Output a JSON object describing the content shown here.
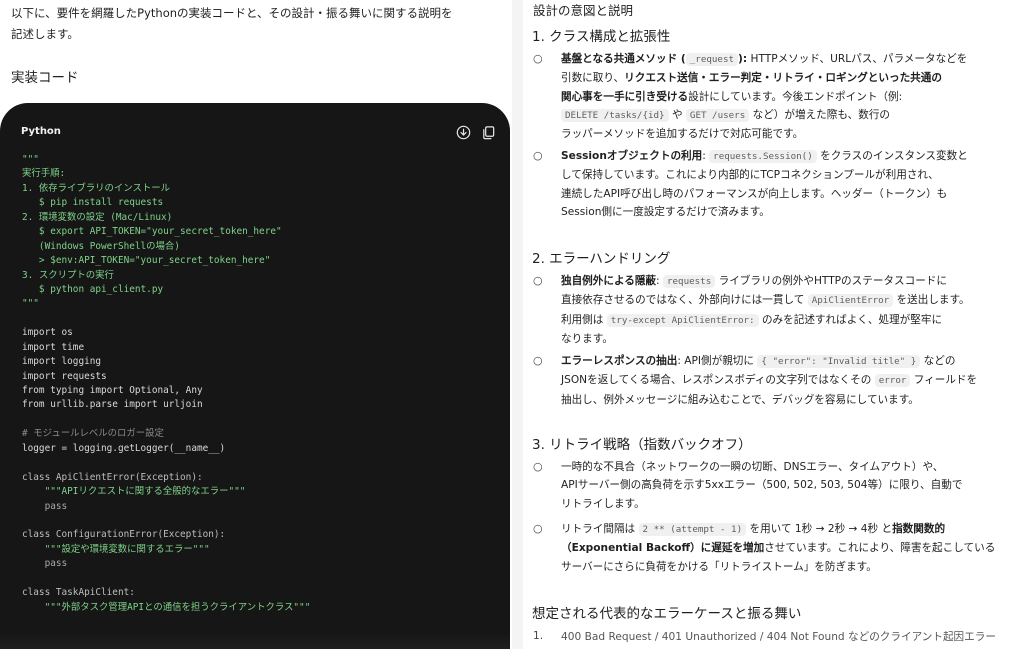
{
  "left": {
    "intro_line1": "以下に、要件を網羅したPythonの実装コードと、その設計・振る舞いに関する説明を",
    "intro_line2": "記述します。",
    "section_heading": "実装コード",
    "code_block": {
      "language": "Python",
      "download_icon": "download-icon",
      "copy_icon": "copy-icon",
      "lines": [
        {
          "t": "\"\"\"",
          "c": "c-doc"
        },
        {
          "t": "実行手順:",
          "c": "c-doc"
        },
        {
          "t": "1. 依存ライブラリのインストール",
          "c": "c-doc"
        },
        {
          "t": "   $ pip install requests",
          "c": "c-doc"
        },
        {
          "t": "2. 環境変数の設定 (Mac/Linux)",
          "c": "c-doc"
        },
        {
          "t": "   $ export API_TOKEN=\"your_secret_token_here\"",
          "c": "c-doc"
        },
        {
          "t": "   (Windows PowerShellの場合)",
          "c": "c-doc"
        },
        {
          "t": "   > $env:API_TOKEN=\"your_secret_token_here\"",
          "c": "c-doc"
        },
        {
          "t": "3. スクリプトの実行",
          "c": "c-doc"
        },
        {
          "t": "   $ python api_client.py",
          "c": "c-doc"
        },
        {
          "t": "\"\"\"",
          "c": "c-doc"
        },
        {
          "t": "",
          "c": ""
        },
        {
          "t": "import os",
          "c": "c-kw"
        },
        {
          "t": "import time",
          "c": "c-kw"
        },
        {
          "t": "import logging",
          "c": "c-kw"
        },
        {
          "t": "import requests",
          "c": "c-kw"
        },
        {
          "t": "from typing import Optional, Any",
          "c": "c-kw"
        },
        {
          "t": "from urllib.parse import urljoin",
          "c": "c-kw"
        },
        {
          "t": "",
          "c": ""
        },
        {
          "t": "# モジュールレベルのロガー設定",
          "c": "c-cmt"
        },
        {
          "t": "logger = logging.getLogger(__name__)",
          "c": "c-kw"
        },
        {
          "t": "",
          "c": ""
        },
        {
          "t": "class ApiClientError(Exception):",
          "c": "c-class"
        },
        {
          "t": "    \"\"\"APIリクエストに関する全般的なエラー\"\"\"",
          "c": "c-doc"
        },
        {
          "t": "    pass",
          "c": "c-dim"
        },
        {
          "t": "",
          "c": ""
        },
        {
          "t": "class ConfigurationError(Exception):",
          "c": "c-class"
        },
        {
          "t": "    \"\"\"設定や環境変数に関するエラー\"\"\"",
          "c": "c-doc"
        },
        {
          "t": "    pass",
          "c": "c-dim"
        },
        {
          "t": "",
          "c": ""
        },
        {
          "t": "class TaskApiClient:",
          "c": "c-class"
        },
        {
          "t": "    \"\"\"外部タスク管理APIとの通信を担うクライアントクラス\"\"\"",
          "c": "c-doc"
        }
      ]
    }
  },
  "right": {
    "title": "設計の意図と説明",
    "sections": [
      {
        "heading": "1. クラス構成と拡張性"
      },
      {
        "heading": "2. エラーハンドリング"
      },
      {
        "heading": "3. リトライ戦略（指数バックオフ）"
      },
      {
        "heading": "想定される代表的なエラーケースと振る舞い"
      }
    ],
    "bullet_glyph": "○",
    "s1": {
      "b1_bold1": "基盤となる共通メソッド (",
      "b1_code1": "_request",
      "b1_bold1_end": "):",
      "b1_t1": " HTTPメソッド、URLパス、パラメータなどを",
      "b1_t2": "引数に取り、",
      "b1_bold2": "リクエスト送信・エラー判定・リトライ・ロギングといった共通の",
      "b1_bold3": "関心事を一手に引き受ける",
      "b1_t3": "設計にしています。今後エンドポイント（例:",
      "b1_code2": "DELETE /tasks/{id}",
      "b1_t4": " や ",
      "b1_code3": "GET /users",
      "b1_t5": " など）が増えた際も、数行の",
      "b1_t6": "ラッパーメソッドを追加するだけで対応可能です。",
      "b2_bold": "Sessionオブジェクトの利用",
      "b2_t1": ": ",
      "b2_code": "requests.Session()",
      "b2_t2": " をクラスのインスタンス変数と",
      "b2_t3": "して保持しています。これにより内部的にTCPコネクションプールが利用され、",
      "b2_t4": "連続したAPI呼び出し時のパフォーマンスが向上します。ヘッダー（トークン）も",
      "b2_t5": "Session側に一度設定するだけで済みます。"
    },
    "s2": {
      "b1_bold": "独自例外による隠蔽",
      "b1_t1": ": ",
      "b1_code1": "requests",
      "b1_t2": " ライブラリの例外やHTTPのステータスコードに",
      "b1_t3": "直接依存させるのではなく、外部向けには一貫して ",
      "b1_code2": "ApiClientError",
      "b1_t4": " を送出します。",
      "b1_t5": "利用側は ",
      "b1_code3": "try-except ApiClientError:",
      "b1_t6": " のみを記述すればよく、処理が堅牢に",
      "b1_t7": "なります。",
      "b2_bold": "エラーレスポンスの抽出",
      "b2_t1": ": API側が親切に ",
      "b2_code1": "{ \"error\": \"Invalid title\" }",
      "b2_t2": " などの",
      "b2_t3": "JSONを返してくる場合、レスポンスボディの文字列ではなくその ",
      "b2_code2": "error",
      "b2_t4": " フィールドを",
      "b2_t5": "抽出し、例外メッセージに組み込むことで、デバッグを容易にしています。"
    },
    "s3": {
      "b1_t1": "一時的な不具合（ネットワークの一瞬の切断、DNSエラー、タイムアウト）や、",
      "b1_t2": "APIサーバー側の高負荷を示す5xxエラー（500, 502, 503, 504等）に限り、自動で",
      "b1_t3": "リトライします。",
      "b2_t1": "リトライ間隔は ",
      "b2_code": "2 ** (attempt - 1)",
      "b2_t2": " を用いて 1秒 → 2秒 → 4秒 と",
      "b2_bold1": "指数関数的",
      "b2_bold2": "（Exponential Backoff）に遅延を増加",
      "b2_t3": "させています。これにより、障害を起こしている",
      "b2_t4": "サーバーにさらに負荷をかける「リトライストーム」を防ぎます。"
    },
    "s4": {
      "item1_num": "1.",
      "item1_text": "400 Bad Request / 401 Unauthorized / 404 Not Found などのクライアント起因エラー"
    }
  }
}
